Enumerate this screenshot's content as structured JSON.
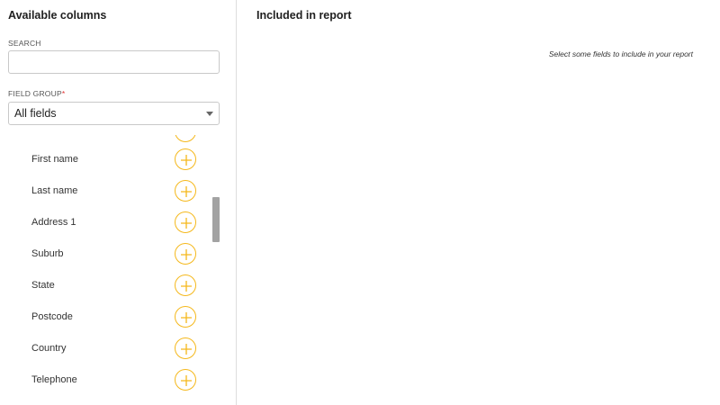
{
  "left_panel": {
    "title": "Available columns",
    "search": {
      "label": "SEARCH",
      "value": "",
      "placeholder": ""
    },
    "field_group": {
      "label": "FIELD GROUP",
      "required_mark": "*",
      "selected": "All fields"
    },
    "fields": [
      {
        "label": "First name"
      },
      {
        "label": "Last name"
      },
      {
        "label": "Address 1"
      },
      {
        "label": "Suburb"
      },
      {
        "label": "State"
      },
      {
        "label": "Postcode"
      },
      {
        "label": "Country"
      },
      {
        "label": "Telephone"
      }
    ]
  },
  "right_panel": {
    "title": "Included in report",
    "empty_message": "Select some fields to include in your report"
  },
  "colors": {
    "accent": "#f5b81b",
    "divider": "#dddddd",
    "scrollbar": "#a3a3a3",
    "required": "#e03131"
  },
  "icons": {
    "add": "plus-circle-icon",
    "dropdown": "chevron-down-icon"
  }
}
